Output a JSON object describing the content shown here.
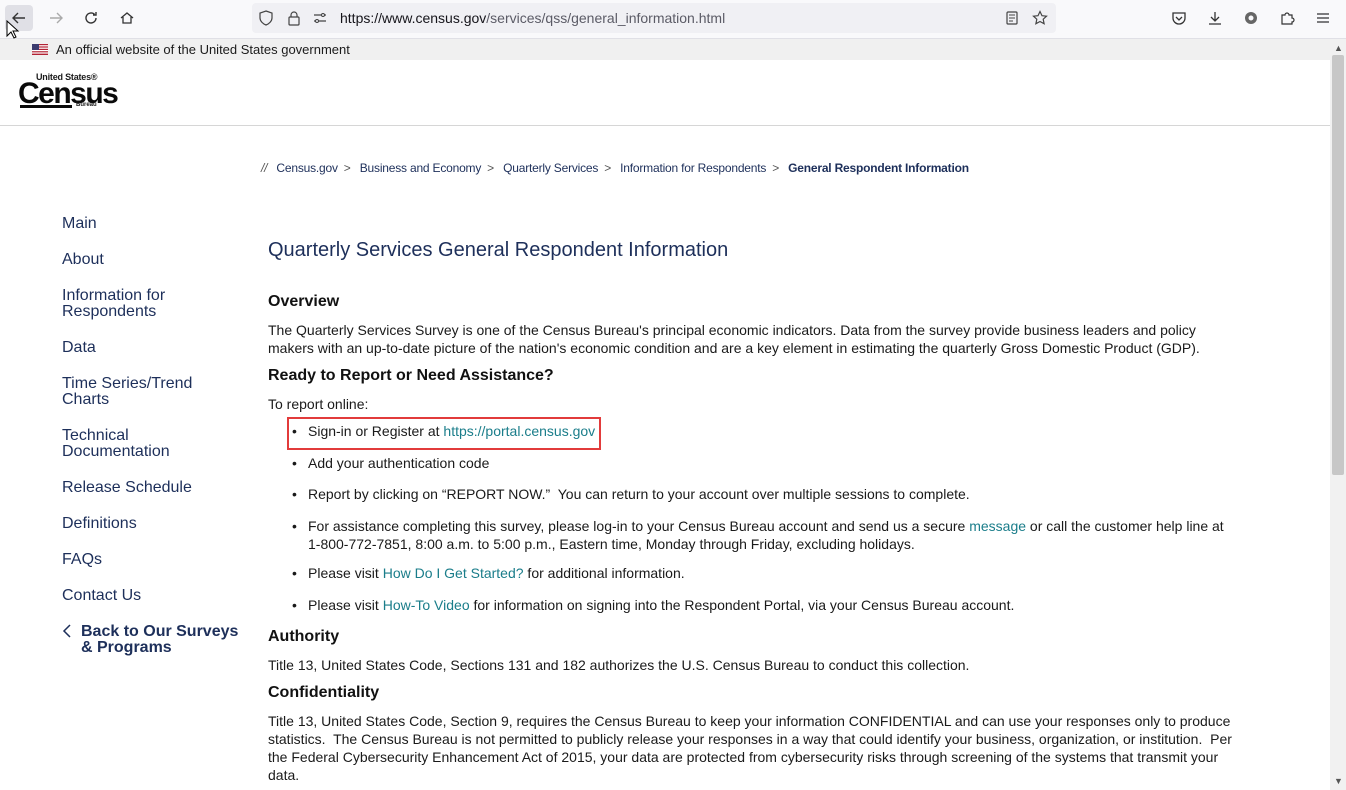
{
  "browser": {
    "url_domain": "https://www.census.gov",
    "url_path": "/services/qss/general_information.html"
  },
  "gov_banner": {
    "text": "An official website of the United States government"
  },
  "logo": {
    "line1": "United States®",
    "line2": "Census",
    "line3": "Bureau"
  },
  "breadcrumb": {
    "slash": "//",
    "items": [
      "Census.gov",
      "Business and Economy",
      "Quarterly Services",
      "Information for Respondents"
    ],
    "current": "General Respondent Information"
  },
  "sidenav": {
    "items": [
      {
        "label": "Main"
      },
      {
        "label": "About"
      },
      {
        "label": "Information for\nRespondents"
      },
      {
        "label": "Data"
      },
      {
        "label": "Time Series/Trend\nCharts"
      },
      {
        "label": "Technical\nDocumentation"
      },
      {
        "label": "Release Schedule"
      },
      {
        "label": "Definitions"
      },
      {
        "label": "FAQs"
      },
      {
        "label": "Contact Us"
      }
    ],
    "back_label": "Back to Our Surveys & Programs"
  },
  "content": {
    "title": "Quarterly Services General Respondent Information",
    "overview_heading": "Overview",
    "overview_text": "The Quarterly Services Survey is one of the Census Bureau's principal economic indicators. Data from the survey provide business leaders and policy makers with an up-to-date picture of the nation's economic condition and are a key element in estimating the quarterly Gross Domestic Product (GDP).",
    "ready_heading": "Ready to Report or Need Assistance?",
    "report_intro": "To report online:",
    "bullet1_text": "Sign-in or Register at ",
    "bullet1_link": "https://portal.census.gov",
    "bullet2_text": "Add your authentication code",
    "bullet3_text": "Report by clicking on “REPORT NOW.”  You can return to your account over multiple sessions to complete.",
    "bullet4_pre": "For assistance completing this survey, please log-in to your Census Bureau account and send us a secure ",
    "bullet4_link": "message",
    "bullet4_post": " or call the customer help line at 1-800-772-7851, 8:00 a.m. to 5:00 p.m., Eastern time, Monday through Friday, excluding holidays.",
    "bullet5_pre": "Please visit ",
    "bullet5_link": "How Do I Get Started?",
    "bullet5_post": " for additional information.",
    "bullet6_pre": "Please visit ",
    "bullet6_link": "How-To Video",
    "bullet6_post": " for information on signing into the Respondent Portal, via your Census Bureau account.",
    "authority_heading": "Authority",
    "authority_text": "Title 13, United States Code, Sections 131 and 182 authorizes the U.S. Census Bureau to conduct this collection.",
    "confidentiality_heading": "Confidentiality",
    "confidentiality_text": "Title 13, United States Code, Section 9, requires the Census Bureau to keep your information CONFIDENTIAL and can use your responses only to produce statistics.  The Census Bureau is not permitted to publicly release your responses in a way that could identify your business, organization, or institution.  Per the Federal Cybersecurity Enhancement Act of 2015, your data are protected from cybersecurity risks through screening of the systems that transmit your data."
  },
  "colors": {
    "navy": "#1d2f5a",
    "link": "#1a7d8a",
    "highlight": "#e23b3b"
  }
}
